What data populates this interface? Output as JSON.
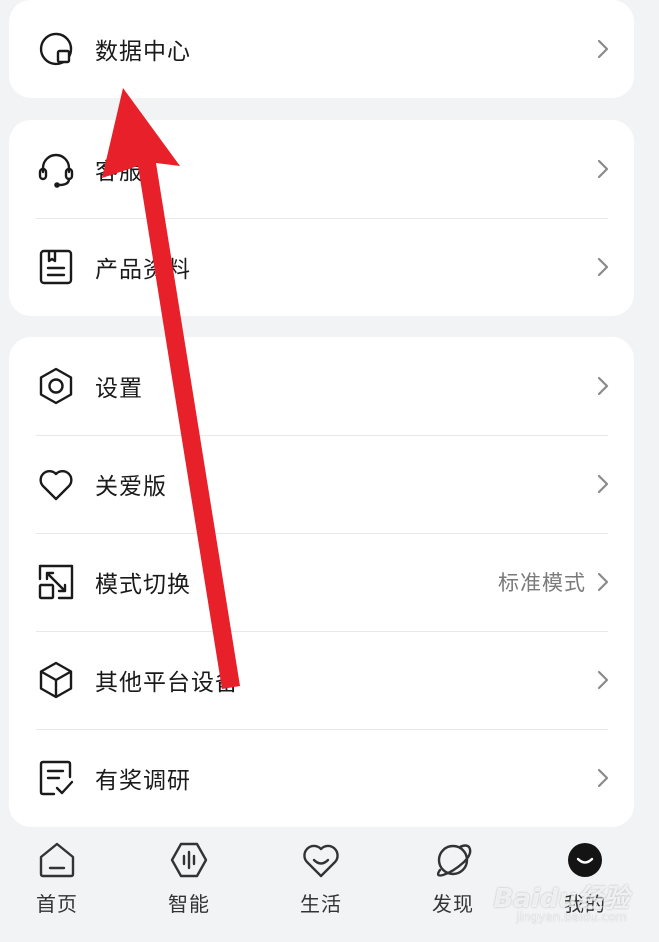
{
  "cards": [
    {
      "rows": [
        {
          "label": "数据中心",
          "value": ""
        }
      ]
    },
    {
      "rows": [
        {
          "label": "客服",
          "value": ""
        },
        {
          "label": "产品资料",
          "value": ""
        }
      ]
    },
    {
      "rows": [
        {
          "label": "设置",
          "value": ""
        },
        {
          "label": "关爱版",
          "value": ""
        },
        {
          "label": "模式切换",
          "value": "标准模式"
        },
        {
          "label": "其他平台设备",
          "value": ""
        },
        {
          "label": "有奖调研",
          "value": ""
        }
      ]
    }
  ],
  "tabs": [
    {
      "label": "首页",
      "icon": "home-icon"
    },
    {
      "label": "智能",
      "icon": "smart-icon"
    },
    {
      "label": "生活",
      "icon": "life-heart-icon"
    },
    {
      "label": "发现",
      "icon": "planet-icon"
    },
    {
      "label": "我的",
      "icon": "profile-smile-icon",
      "active": true
    }
  ],
  "watermark": {
    "brand": "Baidu经验",
    "url": "jingyan.baidu.com"
  },
  "colors": {
    "annotation_arrow": "#e8202a",
    "text_primary": "#1a1a1a",
    "text_secondary": "#7a7a7a",
    "background": "#f1f3f5"
  }
}
